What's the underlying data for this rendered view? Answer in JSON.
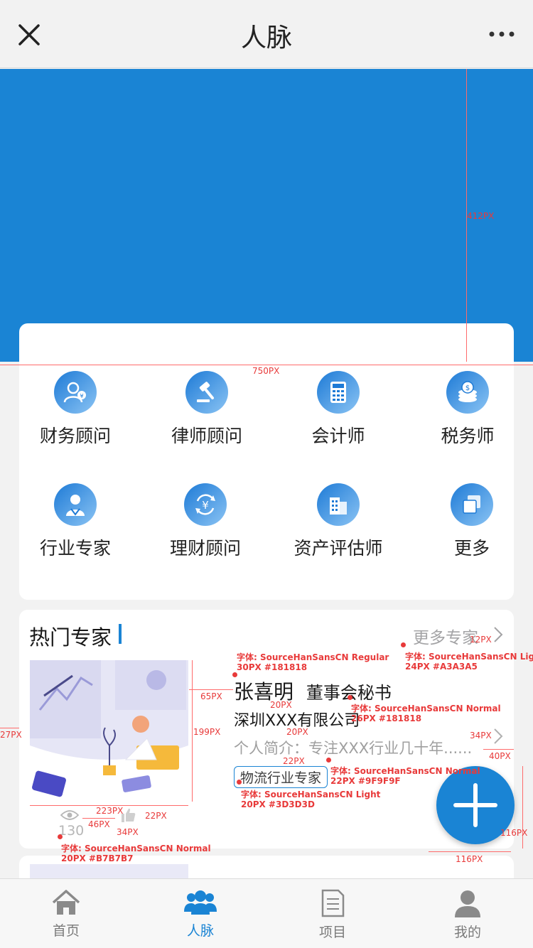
{
  "header": {
    "title": "人脉"
  },
  "categories": [
    {
      "label": "财务顾问",
      "icon": "finance-advisor-icon"
    },
    {
      "label": "律师顾问",
      "icon": "gavel-icon"
    },
    {
      "label": "会计师",
      "icon": "calculator-icon"
    },
    {
      "label": "税务师",
      "icon": "coins-icon"
    },
    {
      "label": "行业专家",
      "icon": "doctor-icon"
    },
    {
      "label": "理财顾问",
      "icon": "yen-cycle-icon"
    },
    {
      "label": "资产评估师",
      "icon": "building-icon"
    },
    {
      "label": "更多",
      "icon": "more-cards-icon"
    }
  ],
  "hot": {
    "title": "热门专家",
    "more": "更多专家",
    "expert": {
      "name": "张喜明",
      "position": "董事会秘书",
      "company": "深圳XXX有限公司",
      "intro": "个人简介：专注XXX行业几十年......",
      "tag": "物流行业专家",
      "views": "130"
    }
  },
  "tabbar": [
    {
      "label": "首页",
      "icon": "home-icon"
    },
    {
      "label": "人脉",
      "icon": "contacts-icon"
    },
    {
      "label": "项目",
      "icon": "document-icon"
    },
    {
      "label": "我的",
      "icon": "user-icon"
    }
  ],
  "annotations": {
    "banner_height": "412PX",
    "screen_width": "750PX",
    "left_margin": "27PX",
    "more_gap": "12PX",
    "name_font": "字体: SourceHanSansCN Regular",
    "name_spec": "30PX #181818",
    "more_font": "字体: SourceHanSansCN Light",
    "more_spec": "24PX #A3A3A5",
    "img_gap": "65PX",
    "img_height": "199PX",
    "gap20a": "20PX",
    "company_font": "字体: SourceHanSansCN Normal",
    "company_spec": "26PX #181818",
    "gap20b": "20PX",
    "chev_h": "34PX",
    "chev_w": "40PX",
    "gap22": "22PX",
    "intro_font": "字体: SourceHanSansCN Normal",
    "intro_spec": "22PX #9F9F9F",
    "tag_font": "字体: SourceHanSansCN Light",
    "tag_spec": "20PX #3D3D3D",
    "img_width": "223PX",
    "icon_gap": "46PX",
    "icon_w": "34PX",
    "icon_h": "22PX",
    "count_font": "字体: SourceHanSansCN Normal",
    "count_spec": "20PX #B7B7B7",
    "fab_h": "116PX",
    "fab_w": "116PX"
  }
}
